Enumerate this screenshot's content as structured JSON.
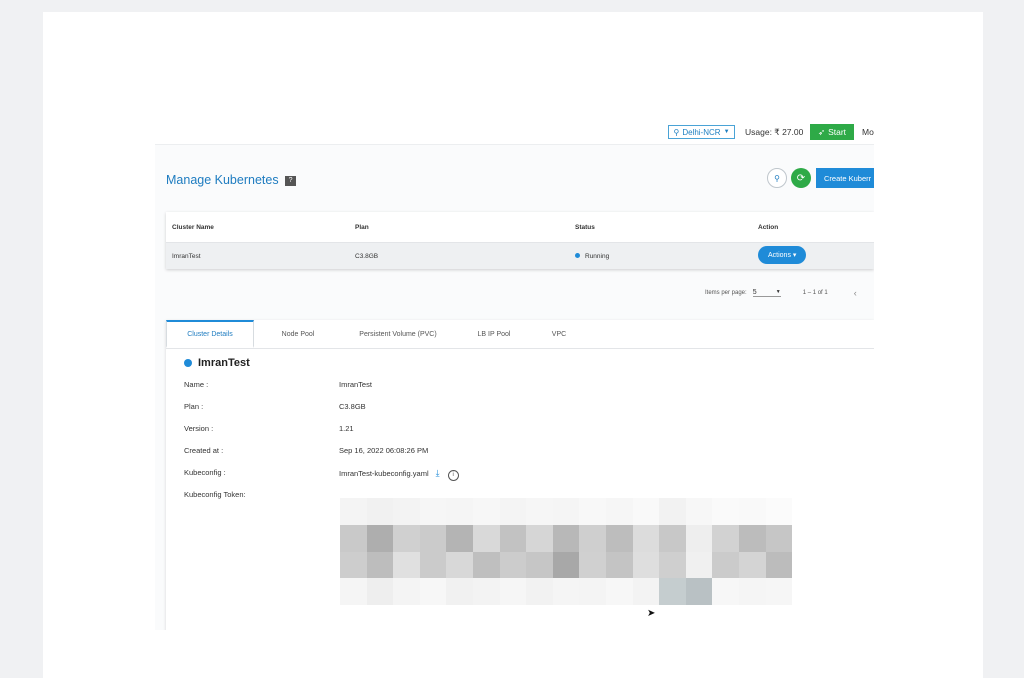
{
  "topbar": {
    "region": "Delhi-NCR",
    "usage": "Usage: ₹ 27.00",
    "start_label": "Start",
    "more_label": "Mo"
  },
  "header": {
    "title": "Manage Kubernetes",
    "help": "?",
    "create_label": "Create Kuberr"
  },
  "table": {
    "columns": [
      "Cluster Name",
      "Plan",
      "Status",
      "Action"
    ],
    "rows": [
      {
        "name": "ImranTest",
        "plan": "C3.8GB",
        "status": "Running",
        "action": "Actions ▾"
      }
    ]
  },
  "paginator": {
    "items_label": "Items per page:",
    "page_size": "5",
    "range": "1 – 1 of 1"
  },
  "tabs": [
    "Cluster Details",
    "Node Pool",
    "Persistent Volume (PVC)",
    "LB IP Pool",
    "VPC"
  ],
  "details": {
    "cluster_name": "ImranTest",
    "fields": [
      {
        "label": "Name :",
        "value": "ImranTest"
      },
      {
        "label": "Plan :",
        "value": "C3.8GB"
      },
      {
        "label": "Version :",
        "value": "1.21"
      },
      {
        "label": "Created at :",
        "value": "Sep 16, 2022 06:08:26 PM"
      },
      {
        "label": "Kubeconfig :",
        "value": "ImranTest-kubeconfig.yaml"
      },
      {
        "label": "Kubeconfig Token:",
        "value": ""
      }
    ]
  },
  "colors": {
    "accent": "#1f8bd8",
    "success": "#2eaa47",
    "title": "#1e7cc0"
  },
  "icons": [
    "location-pin-icon",
    "chevron-down-icon",
    "paper-plane-icon",
    "search-icon",
    "refresh-icon",
    "download-icon",
    "info-icon",
    "chevron-left-icon",
    "mouse-cursor-icon"
  ]
}
